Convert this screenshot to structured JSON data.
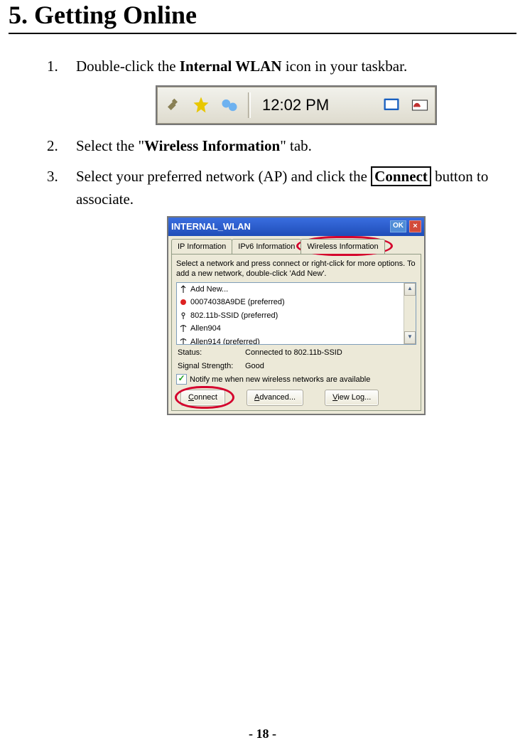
{
  "heading": "5. Getting Online",
  "steps": {
    "s1_prefix": "Double-click the ",
    "s1_bold": "Internal WLAN",
    "s1_suffix": " icon in your taskbar.",
    "s2_prefix": "Select the \"",
    "s2_bold": "Wireless Information",
    "s2_suffix": "\" tab.",
    "s3_prefix": "Select your preferred network (AP) and click the ",
    "s3_box": "Connect",
    "s3_suffix_a": " button to associate."
  },
  "taskbar": {
    "time": "12:02 PM"
  },
  "wlan": {
    "title": "INTERNAL_WLAN",
    "ok": "OK",
    "close": "×",
    "tabs": [
      "IP Information",
      "IPv6 Information",
      "Wireless Information"
    ],
    "instructions": "Select a network and press connect or right-click for more options.  To add a new network, double-click 'Add New'.",
    "networks": {
      "n0": "Add New...",
      "n1": "00074038A9DE (preferred)",
      "n2": "802.11b-SSID (preferred)",
      "n3": "Allen904",
      "n4": "Allen914 (preferred)"
    },
    "status_label": "Status:",
    "status_value": "Connected to 802.11b-SSID",
    "signal_label": "Signal Strength:",
    "signal_value": "Good",
    "notify": "Notify me when new wireless networks are available",
    "buttons": {
      "connect": "Connect",
      "advanced": "Advanced...",
      "viewlog": "View Log..."
    },
    "accel": {
      "connect_u": "C",
      "advanced_u": "A",
      "viewlog_u": "V"
    }
  },
  "page_number": "- 18 -"
}
